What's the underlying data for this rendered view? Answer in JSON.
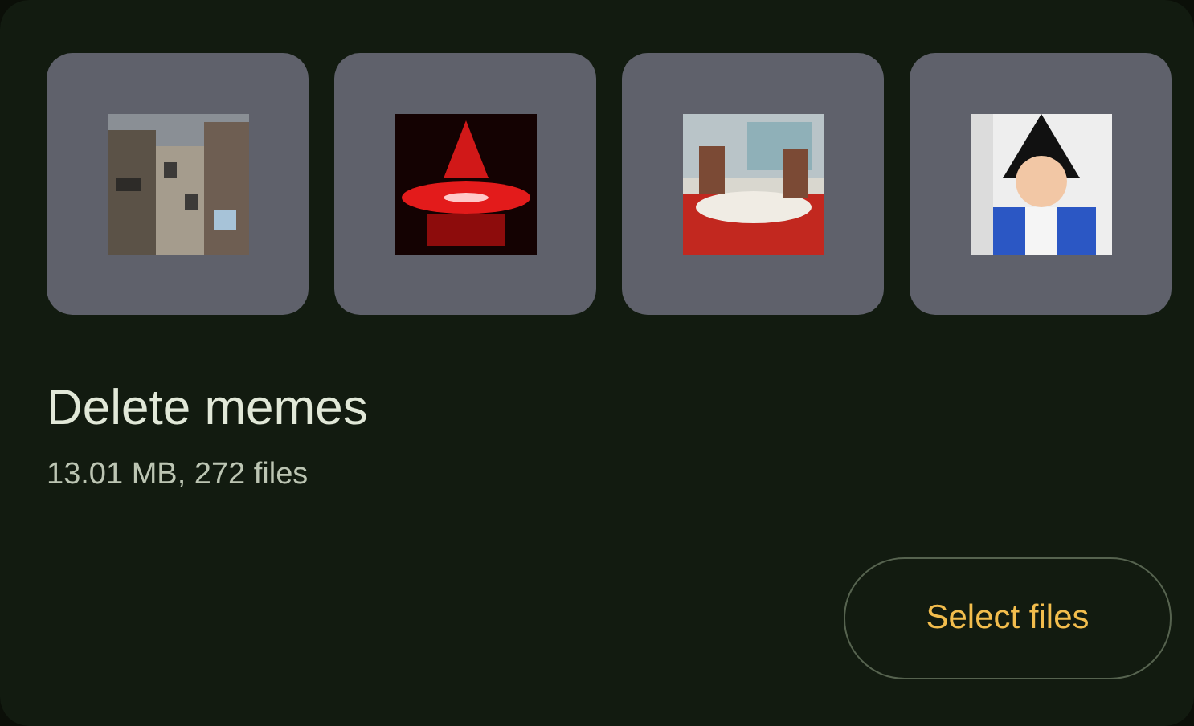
{
  "title": "Delete memes",
  "subtitle": "13.01 MB, 272 files",
  "button": {
    "label": "Select files"
  }
}
